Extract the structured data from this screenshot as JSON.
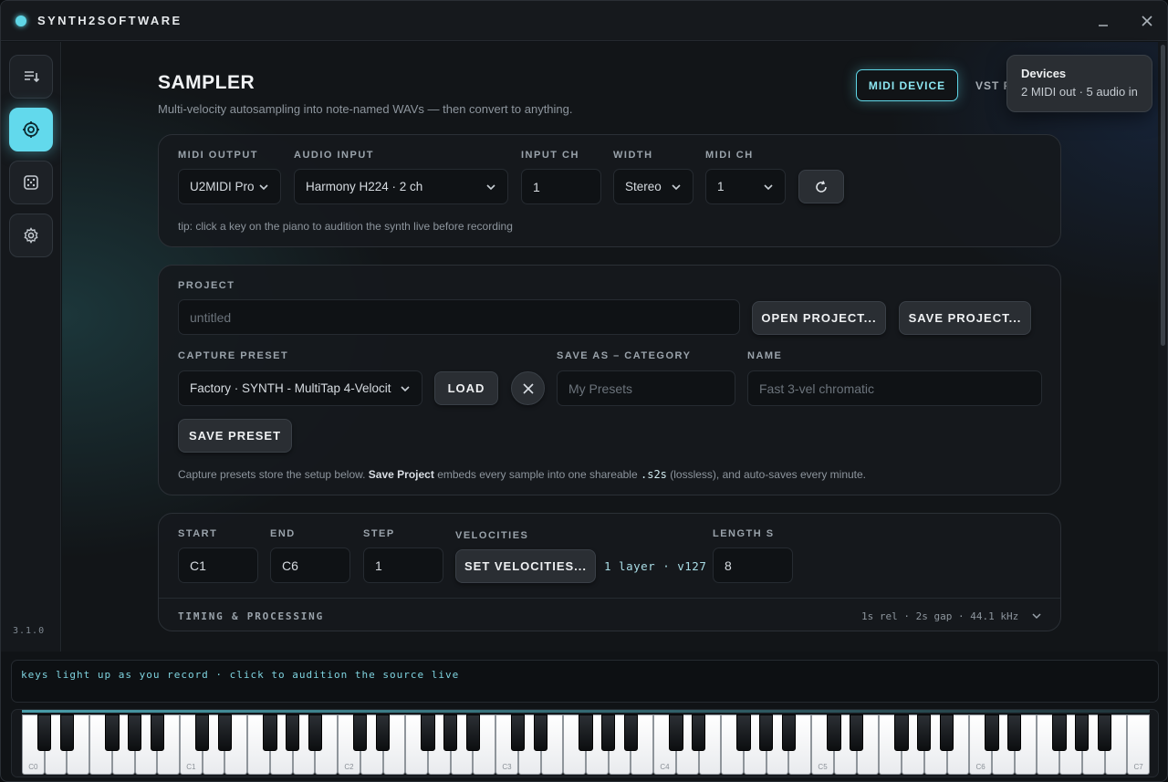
{
  "app": {
    "title": "SYNTH2SOFTWARE",
    "version": "3.1.0",
    "minimize_icon": "minimize-icon",
    "close_icon": "close-icon"
  },
  "sidebar": {
    "items": [
      {
        "name": "queue",
        "icon": "playlist-icon",
        "active": false
      },
      {
        "name": "sampler",
        "icon": "target-icon",
        "active": true
      },
      {
        "name": "random",
        "icon": "dice-icon",
        "active": false
      },
      {
        "name": "settings",
        "icon": "gear-icon",
        "active": false
      }
    ]
  },
  "header": {
    "title": "SAMPLER",
    "subtitle": "Multi-velocity autosampling into note-named WAVs — then convert to anything.",
    "mode_tabs": [
      "MIDI DEVICE",
      "VST P"
    ],
    "active_mode": "MIDI DEVICE"
  },
  "tooltip": {
    "title": "Devices",
    "body": "2 MIDI out · 5 audio in"
  },
  "io": {
    "midi_output_label": "MIDI OUTPUT",
    "midi_output_value": "U2MIDI Pro",
    "audio_input_label": "AUDIO INPUT",
    "audio_input_value": "Harmony H224 · 2 ch",
    "input_ch_label": "INPUT CH",
    "input_ch_value": "1",
    "width_label": "WIDTH",
    "width_value": "Stereo",
    "midi_ch_label": "MIDI CH",
    "midi_ch_value": "1",
    "refresh_icon": "refresh-icon",
    "tip": "tip: click a key on the piano to audition the synth live before recording"
  },
  "project": {
    "project_label": "PROJECT",
    "project_placeholder": "untitled",
    "open_label": "OPEN PROJECT...",
    "save_label": "SAVE PROJECT...",
    "capture_preset_label": "CAPTURE PRESET",
    "capture_preset_value": "Factory · SYNTH - MultiTap 4-Velocit",
    "load_label": "LOAD",
    "clear_icon": "close-icon",
    "save_as_label": "SAVE AS – CATEGORY",
    "save_as_placeholder": "My Presets",
    "name_label": "NAME",
    "name_placeholder": "Fast 3-vel chromatic",
    "save_preset_label": "SAVE PRESET",
    "note_prefix": "Capture presets store the setup below.",
    "note_bold": "Save Project",
    "note_mid": "embeds every sample into one shareable",
    "note_code": ".s2s",
    "note_suffix": "(lossless), and auto-saves every minute."
  },
  "range": {
    "start_label": "START",
    "start_value": "C1",
    "end_label": "END",
    "end_value": "C6",
    "step_label": "STEP",
    "step_value": "1",
    "velocities_label": "VELOCITIES",
    "set_velocities_label": "SET VELOCITIES...",
    "velocities_summary": "1 layer · v127",
    "length_label": "LENGTH S",
    "length_value": "8",
    "timing_label": "TIMING & PROCESSING",
    "timing_summary": "1s rel · 2s gap · 44.1 kHz"
  },
  "keyboard": {
    "status": "keys light up as you record · click to audition the source live",
    "octave_labels": [
      "C0",
      "C1",
      "C2",
      "C3",
      "C4",
      "C5",
      "C6",
      "C7"
    ]
  },
  "colors": {
    "accent": "#62d9ec",
    "background": "#121518",
    "panel": "#16191d"
  }
}
